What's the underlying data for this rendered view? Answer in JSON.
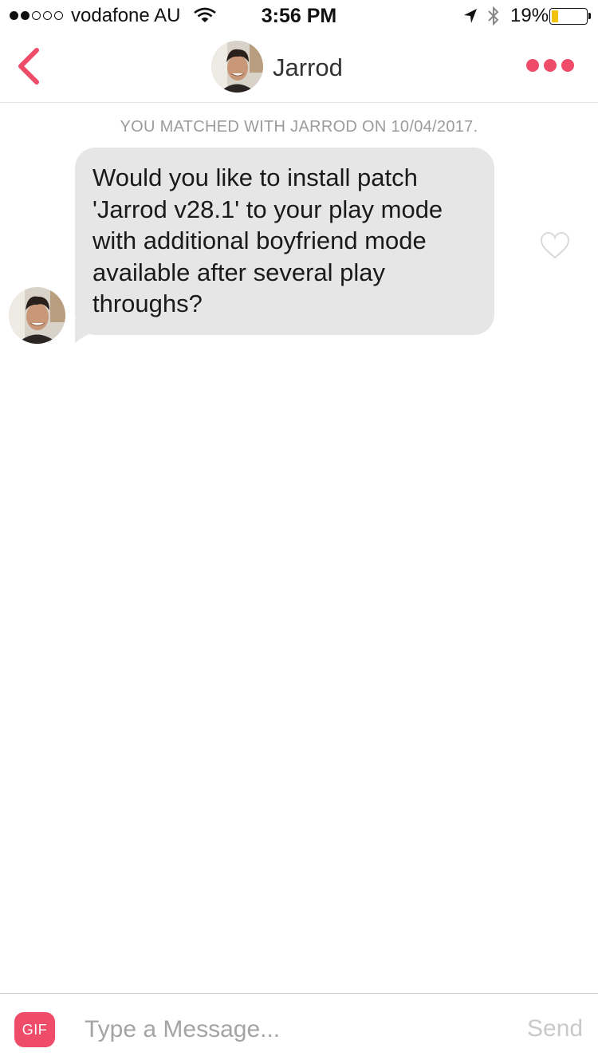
{
  "status_bar": {
    "signal_bars_filled": 2,
    "signal_bars_total": 5,
    "carrier": "vodafone AU",
    "time": "3:56 PM",
    "battery_percent": "19%",
    "battery_level": 0.19,
    "battery_color": "#f4c20d",
    "icons": [
      "wifi-icon",
      "location-arrow-icon",
      "bluetooth-icon",
      "battery-icon"
    ]
  },
  "nav": {
    "title": "Jarrod",
    "back_icon": "chevron-left-icon",
    "more_icon": "more-dots-icon",
    "accent_color": "#ee4c68"
  },
  "chat": {
    "match_info": "YOU MATCHED WITH JARROD ON 10/04/2017.",
    "messages": [
      {
        "sender": "Jarrod",
        "lines": [
          "Would you like to install patch",
          "'Jarrod v28.1' to your play mode",
          "with additional boyfriend mode",
          "available after several play",
          "throughs?"
        ],
        "liked": false
      }
    ]
  },
  "input_bar": {
    "gif_label": "GIF",
    "placeholder": "Type a Message...",
    "value": "",
    "send_label": "Send"
  }
}
